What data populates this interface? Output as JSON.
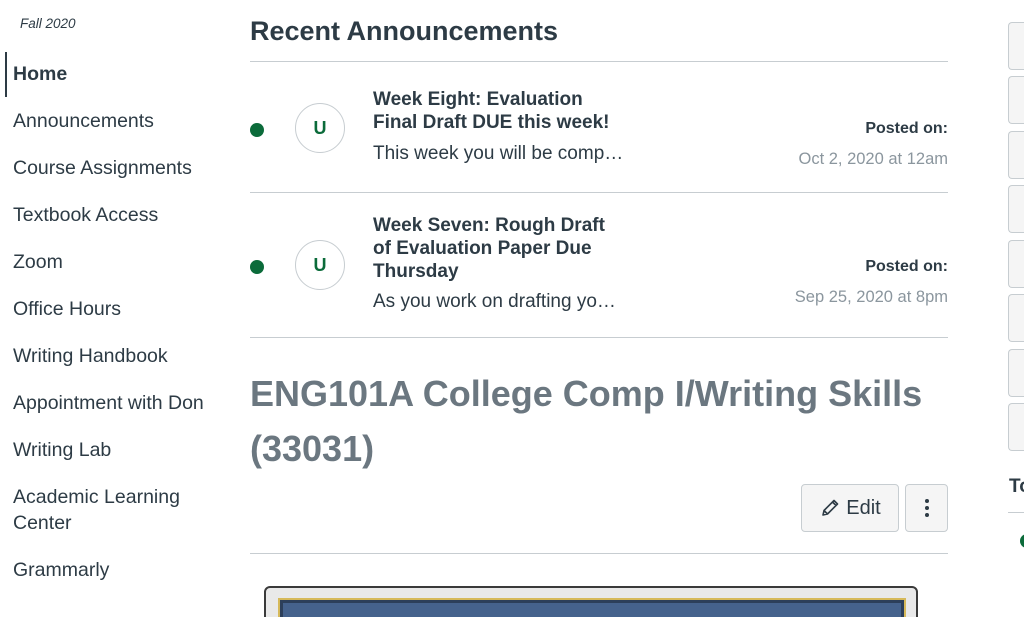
{
  "course_nav": {
    "term": "Fall 2020",
    "items": [
      {
        "label": "Home",
        "active": true
      },
      {
        "label": "Announcements"
      },
      {
        "label": "Course Assignments"
      },
      {
        "label": "Textbook Access"
      },
      {
        "label": "Zoom"
      },
      {
        "label": "Office Hours"
      },
      {
        "label": "Writing Handbook"
      },
      {
        "label": "Appointment with Don"
      },
      {
        "label": "Writing Lab"
      },
      {
        "label": "Academic Learning Center"
      },
      {
        "label": "Grammarly"
      }
    ]
  },
  "announcements": {
    "heading": "Recent Announcements",
    "items": [
      {
        "avatar_initial": "U",
        "title": "Week Eight: Evaluation Final Draft DUE this week!",
        "snippet": "This week you will be comp…",
        "posted_label": "Posted on:",
        "posted_date": "Oct 2, 2020 at 12am",
        "unread": true
      },
      {
        "avatar_initial": "U",
        "title": "Week Seven: Rough Draft of Evaluation Paper Due Thursday",
        "snippet": "As you work on drafting yo…",
        "posted_label": "Posted on:",
        "posted_date": "Sep 25, 2020 at 8pm",
        "unread": true
      }
    ]
  },
  "course": {
    "title": "ENG101A College Comp I/Writing Skills (33031)",
    "edit_label": "Edit"
  },
  "right_sidebar": {
    "todo_heading": "To"
  },
  "colors": {
    "text": "#2d3b45",
    "muted": "#8b969e",
    "accent_green": "#0b6b3a",
    "divider": "#c7cdd1",
    "course_title": "#6b7780"
  },
  "icons": {
    "edit": "pencil-icon",
    "more": "kebab-menu-icon",
    "unread": "unread-dot-icon"
  }
}
